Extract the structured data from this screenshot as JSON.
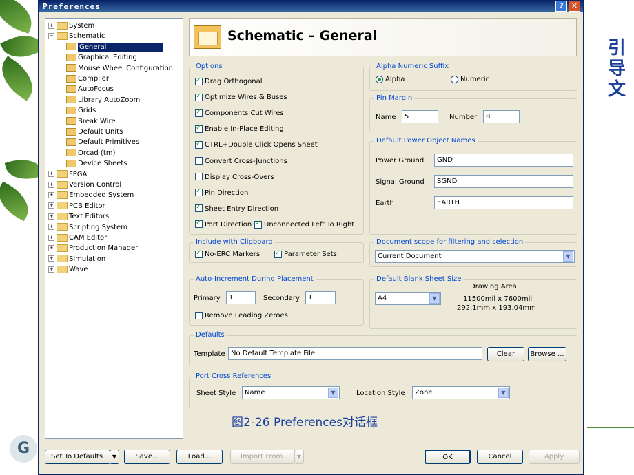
{
  "window": {
    "title": "Preferences",
    "help_glyph": "?",
    "close_glyph": "✕"
  },
  "side_heading": "引导文",
  "caption": "图2-26  Preferences对话框",
  "tree": [
    {
      "label": "System",
      "level": 0,
      "expander": "+",
      "type": "folder"
    },
    {
      "label": "Schematic",
      "level": 0,
      "expander": "−",
      "type": "folder"
    },
    {
      "label": "General",
      "level": 1,
      "selected": true,
      "type": "doc"
    },
    {
      "label": "Graphical Editing",
      "level": 1,
      "type": "doc"
    },
    {
      "label": "Mouse Wheel Configuration",
      "level": 1,
      "type": "doc"
    },
    {
      "label": "Compiler",
      "level": 1,
      "type": "doc"
    },
    {
      "label": "AutoFocus",
      "level": 1,
      "type": "doc"
    },
    {
      "label": "Library AutoZoom",
      "level": 1,
      "type": "doc"
    },
    {
      "label": "Grids",
      "level": 1,
      "type": "doc"
    },
    {
      "label": "Break Wire",
      "level": 1,
      "type": "doc"
    },
    {
      "label": "Default Units",
      "level": 1,
      "type": "doc"
    },
    {
      "label": "Default Primitives",
      "level": 1,
      "type": "doc"
    },
    {
      "label": "Orcad (tm)",
      "level": 1,
      "type": "doc"
    },
    {
      "label": "Device Sheets",
      "level": 1,
      "type": "doc"
    },
    {
      "label": "FPGA",
      "level": 0,
      "expander": "+",
      "type": "folder"
    },
    {
      "label": "Version Control",
      "level": 0,
      "expander": "+",
      "type": "folder"
    },
    {
      "label": "Embedded System",
      "level": 0,
      "expander": "+",
      "type": "folder"
    },
    {
      "label": "PCB Editor",
      "level": 0,
      "expander": "+",
      "type": "folder"
    },
    {
      "label": "Text Editors",
      "level": 0,
      "expander": "+",
      "type": "folder"
    },
    {
      "label": "Scripting System",
      "level": 0,
      "expander": "+",
      "type": "folder"
    },
    {
      "label": "CAM Editor",
      "level": 0,
      "expander": "+",
      "type": "folder"
    },
    {
      "label": "Production Manager",
      "level": 0,
      "expander": "+",
      "type": "folder"
    },
    {
      "label": "Simulation",
      "level": 0,
      "expander": "+",
      "type": "folder"
    },
    {
      "label": "Wave",
      "level": 0,
      "expander": "+",
      "type": "folder"
    }
  ],
  "header": {
    "title": "Schematic – General"
  },
  "options": {
    "title": "Options",
    "items": [
      {
        "label": "Drag Orthogonal",
        "checked": true
      },
      {
        "label": "Optimize Wires & Buses",
        "checked": true
      },
      {
        "label": "Components Cut Wires",
        "checked": true
      },
      {
        "label": "Enable In-Place Editing",
        "checked": true
      },
      {
        "label": "CTRL+Double Click Opens Sheet",
        "checked": true
      },
      {
        "label": "Convert Cross-Junctions",
        "checked": false
      },
      {
        "label": "Display Cross-Overs",
        "checked": false
      },
      {
        "label": "Pin Direction",
        "checked": true
      },
      {
        "label": "Sheet Entry Direction",
        "checked": true
      },
      {
        "label": "Port Direction",
        "checked": true
      }
    ],
    "unconnected": {
      "label": "Unconnected Left To Right",
      "checked": true
    }
  },
  "suffix": {
    "title": "Alpha Numeric Suffix",
    "alpha": "Alpha",
    "numeric": "Numeric",
    "selected": "Alpha"
  },
  "pin_margin": {
    "title": "Pin Margin",
    "name_label": "Name",
    "name_value": "5",
    "number_label": "Number",
    "number_value": "8"
  },
  "power": {
    "title": "Default Power Object Names",
    "power_ground_label": "Power Ground",
    "power_ground_value": "GND",
    "signal_ground_label": "Signal Ground",
    "signal_ground_value": "SGND",
    "earth_label": "Earth",
    "earth_value": "EARTH"
  },
  "clipboard": {
    "title": "Include with Clipboard",
    "no_erc": "No-ERC Markers",
    "no_erc_checked": true,
    "param_sets": "Parameter Sets",
    "param_sets_checked": true
  },
  "scope": {
    "title": "Document scope for filtering and selection",
    "value": "Current Document"
  },
  "auto_increment": {
    "title": "Auto-Increment During Placement",
    "primary_label": "Primary",
    "primary_value": "1",
    "secondary_label": "Secondary",
    "secondary_value": "1",
    "remove_zeroes": "Remove Leading Zeroes",
    "remove_zeroes_checked": false
  },
  "blank_sheet": {
    "title": "Default Blank Sheet Size",
    "value": "A4",
    "area_title": "Drawing Area",
    "area_mil": "11500mil x 7600mil",
    "area_mm": "292.1mm x 193.04mm"
  },
  "defaults": {
    "title": "Defaults",
    "template_label": "Template",
    "template_value": "No Default Template File",
    "clear": "Clear",
    "browse": "Browse ..."
  },
  "port_cross": {
    "title": "Port Cross References",
    "sheet_style_label": "Sheet Style",
    "sheet_style_value": "Name",
    "location_style_label": "Location Style",
    "location_style_value": "Zone"
  },
  "footer": {
    "set_defaults": "Set To Defaults",
    "save": "Save...",
    "load": "Load...",
    "import": "Import From...",
    "ok": "OK",
    "cancel": "Cancel",
    "apply": "Apply"
  },
  "logo_text": "G"
}
